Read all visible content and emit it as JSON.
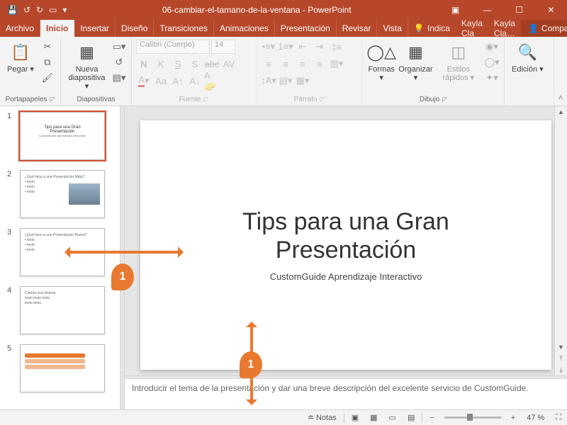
{
  "title": "06-cambiar-el-tamano-de-la-ventana  -  PowerPoint",
  "tabs": {
    "archivo": "Archivo",
    "inicio": "Inicio",
    "insertar": "Insertar",
    "diseno": "Diseño",
    "transiciones": "Transiciones",
    "animaciones": "Animaciones",
    "presentacion": "Presentación",
    "revisar": "Revisar",
    "vista": "Vista"
  },
  "tell_me": "Indica",
  "user1": "Kayla Cla",
  "user2": "Kayla Cla…",
  "share": "Compartir",
  "ribbon": {
    "portapapeles": {
      "label": "Portapapeles",
      "pegar": "Pegar"
    },
    "diapositivas": {
      "label": "Diapositivas",
      "nueva": "Nueva diapositiva"
    },
    "fuente": {
      "label": "Fuente",
      "font_name": "Calibri (Cuerpo)",
      "font_size": "14"
    },
    "parrafo": {
      "label": "Párrafo"
    },
    "dibujo": {
      "label": "Dibujo",
      "formas": "Formas",
      "organizar": "Organizar",
      "estilos": "Estilos rápidos"
    },
    "edicion": {
      "label": "Edición"
    }
  },
  "slide": {
    "title_line1": "Tips para una Gran",
    "title_line2": "Presentación",
    "subtitle": "CustomGuide Aprendizaje Interactivo"
  },
  "notes_text": "Introducir el tema de la presentación y dar una breve descripción del excelente servicio de CustomGuide.",
  "status": {
    "notas": "Notas",
    "zoom_pct": "47 %"
  },
  "thumbs": [
    "1",
    "2",
    "3",
    "4",
    "5"
  ],
  "callouts": {
    "one": "1"
  }
}
